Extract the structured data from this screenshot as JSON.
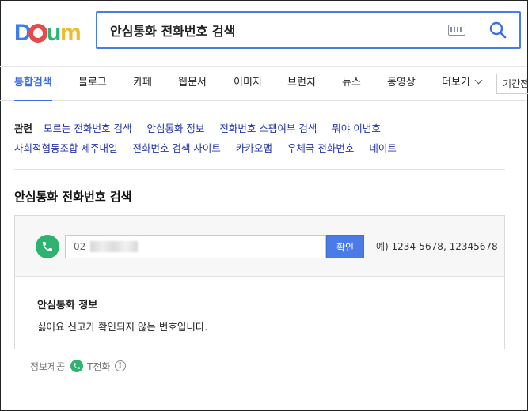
{
  "header": {
    "logo_text": "Daum",
    "search_query": "안심통화 전화번호 검색"
  },
  "tabs": [
    {
      "label": "통합검색",
      "active": true
    },
    {
      "label": "블로그"
    },
    {
      "label": "카페"
    },
    {
      "label": "웹문서"
    },
    {
      "label": "이미지"
    },
    {
      "label": "브런치"
    },
    {
      "label": "뉴스"
    },
    {
      "label": "동영상"
    },
    {
      "label": "더보기"
    }
  ],
  "period_filter": "기간전체",
  "related": {
    "label": "관련",
    "items": [
      "모르는 전화번호 검색",
      "안심통화 정보",
      "전화번호 스팸여부 검색",
      "뭐야 이번호",
      "사회적협동조합 제주내일",
      "전화번호 검색 사이트",
      "카카오맵",
      "우체국 전화번호",
      "네이트"
    ]
  },
  "section": {
    "title": "안심통화 전화번호 검색",
    "phone_value": "02",
    "confirm_label": "확인",
    "example_text": "예) 1234-5678, 12345678",
    "info_title": "안심통화 정보",
    "info_text": "싫어요 신고가 확인되지 않는 번호입니다."
  },
  "provider": {
    "label": "정보제공",
    "name": "T전화"
  },
  "colors": {
    "accent": "#4a7be6",
    "link": "#2233aa",
    "call_green": "#2db36f",
    "logo_blue": "#3d7df2",
    "logo_red": "#e64b4b",
    "logo_yellow": "#f2b92b",
    "logo_green": "#29b573"
  }
}
